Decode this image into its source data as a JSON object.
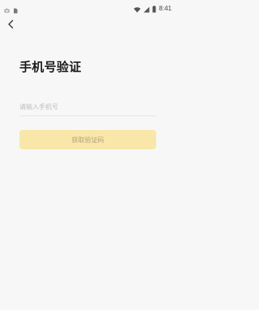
{
  "status_bar": {
    "time": "8:41",
    "left_icons": [
      "usb-icon",
      "sim-card-icon"
    ],
    "right_icons": [
      "wifi-icon",
      "signal-icon",
      "battery-icon"
    ]
  },
  "header": {
    "back_icon": "chevron-left-icon"
  },
  "main": {
    "title": "手机号验证",
    "phone_input": {
      "placeholder": "请输入手机号",
      "value": ""
    },
    "get_code_button": {
      "label": "获取验证码",
      "state": "disabled"
    }
  },
  "colors": {
    "background": "#f7f7f7",
    "button_background": "#f8e7a8",
    "button_text": "#b2a27a",
    "placeholder_text": "#bdbdbd",
    "title_text": "#1a1a1a"
  }
}
